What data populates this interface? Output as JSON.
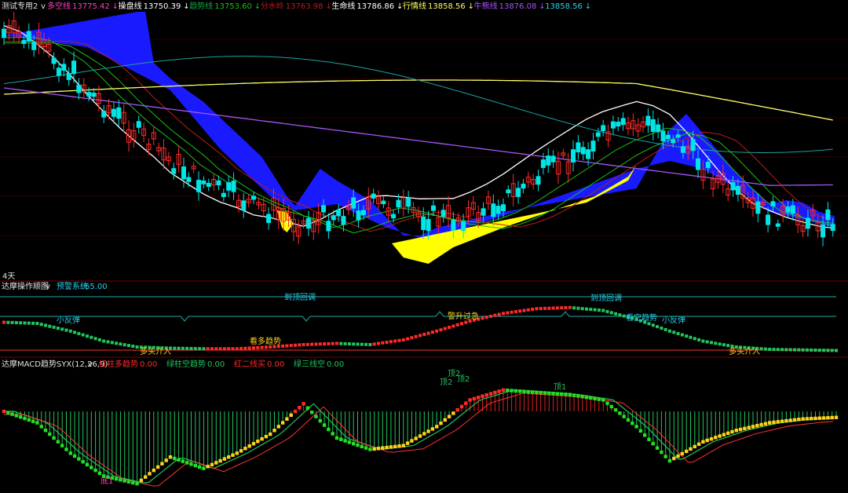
{
  "top_legend": {
    "selector_label": "测试专用2",
    "arrow": "v",
    "items": [
      {
        "name": "多空线",
        "value": "13775.42",
        "trend": "↓",
        "name_color": "#ff3fbf",
        "value_color": "#ff3fbf"
      },
      {
        "name": "操盘线",
        "value": "13750.39",
        "trend": "↓",
        "name_color": "#ffffff",
        "value_color": "#ffffff"
      },
      {
        "name": "趋势线",
        "value": "13753.60",
        "trend": "↓",
        "name_color": "#16a34a",
        "value_color": "#19c019"
      },
      {
        "name": "分水岭",
        "value": "13763.98",
        "trend": "↓",
        "name_color": "#b91c1c",
        "value_color": "#b91c1c"
      },
      {
        "name": "生命线",
        "value": "13786.86",
        "trend": "↓",
        "name_color": "#ffffff",
        "value_color": "#ffffff"
      },
      {
        "name": "行情线",
        "value": "13858.56",
        "trend": "↓",
        "name_color": "#ffff66",
        "value_color": "#ffff66"
      },
      {
        "name": "牛熊线",
        "value": "13876.08",
        "trend": "↓",
        "name_color": "#a855f7",
        "value_color": "#a855f7"
      },
      {
        "name": "",
        "value": "13858.56",
        "trend": "↓",
        "name_color": "#22d3ee",
        "value_color": "#22d3ee"
      }
    ]
  },
  "main_corner_label": "4天",
  "panel2": {
    "title": "达摩操作顺图",
    "arrow": "v",
    "sub_label": "预警系统",
    "sub_value": "65.00",
    "annotations": [
      {
        "text": "到顶回调",
        "color": "#22d3ee"
      },
      {
        "text": "小反弹",
        "color": "#22d3ee"
      },
      {
        "text": "警升过急",
        "color": "#ffd21a"
      },
      {
        "text": "到顶回调",
        "color": "#22d3ee"
      },
      {
        "text": "看空趋势",
        "color": "#22d3ee"
      },
      {
        "text": "小反弹",
        "color": "#22d3ee"
      },
      {
        "text": "多头介入",
        "color": "#ffd21a"
      },
      {
        "text": "看多趋势",
        "color": "#ffd21a"
      },
      {
        "text": "多头介入",
        "color": "#ffd21a"
      }
    ]
  },
  "panel3": {
    "title": "达摩MACD趋势SYX(12,26,9)",
    "arrow": "v",
    "items": [
      {
        "name": "红柱多趋势",
        "value": "0.00",
        "color": "#ff2b2b"
      },
      {
        "name": "绿柱空趋势",
        "value": "0.00",
        "color": "#22c55e"
      },
      {
        "name": "红二线买",
        "value": "0.00",
        "color": "#ff2b2b"
      },
      {
        "name": "绿三线空",
        "value": "0.00",
        "color": "#22c55e"
      }
    ],
    "annotations": [
      {
        "text": "顶2",
        "color": "#22c55e"
      },
      {
        "text": "顶2",
        "color": "#22c55e"
      },
      {
        "text": "顶2",
        "color": "#22c55e"
      },
      {
        "text": "顶1",
        "color": "#22c55e"
      },
      {
        "text": "底1",
        "color": "#ff3fbf"
      }
    ]
  },
  "colors": {
    "background": "#000000",
    "up_candle": "#ff2b2b",
    "down_candle": "#00e5e5",
    "blue_band": "#1a1aff",
    "yellow_band": "#ffff00",
    "divider": "#7a0000"
  },
  "chart_data": [
    {
      "type": "candlestick",
      "title": "测试专用2",
      "note": "main price panel with moving-average lines and shaded bands; prices approximate",
      "ylim": [
        13300,
        14500
      ],
      "close_points": [
        [
          0,
          14410
        ],
        [
          10,
          14395
        ],
        [
          20,
          14350
        ],
        [
          30,
          14300
        ],
        [
          40,
          14230
        ],
        [
          50,
          14150
        ],
        [
          60,
          14080
        ],
        [
          70,
          14010
        ],
        [
          80,
          13950
        ],
        [
          90,
          13890
        ],
        [
          100,
          13820
        ],
        [
          110,
          13770
        ],
        [
          120,
          13720
        ],
        [
          130,
          13680
        ],
        [
          140,
          13650
        ],
        [
          150,
          13610
        ],
        [
          160,
          13590
        ],
        [
          170,
          13560
        ],
        [
          180,
          13530
        ],
        [
          190,
          13550
        ],
        [
          200,
          13580
        ],
        [
          210,
          13600
        ],
        [
          220,
          13620
        ],
        [
          230,
          13610
        ],
        [
          240,
          13590
        ],
        [
          250,
          13570
        ],
        [
          260,
          13560
        ],
        [
          270,
          13550
        ],
        [
          280,
          13570
        ],
        [
          290,
          13600
        ],
        [
          300,
          13640
        ],
        [
          310,
          13690
        ],
        [
          320,
          13740
        ],
        [
          330,
          13790
        ],
        [
          340,
          13840
        ],
        [
          350,
          13890
        ],
        [
          360,
          13930
        ],
        [
          370,
          13960
        ],
        [
          380,
          13990
        ],
        [
          390,
          13980
        ],
        [
          400,
          13950
        ],
        [
          410,
          13880
        ],
        [
          420,
          13800
        ],
        [
          430,
          13720
        ],
        [
          440,
          13650
        ],
        [
          450,
          13600
        ],
        [
          460,
          13580
        ],
        [
          470,
          13560
        ],
        [
          480,
          13550
        ],
        [
          490,
          13540
        ]
      ],
      "series": [
        {
          "name": "多空线",
          "color": "#ff3fbf"
        },
        {
          "name": "操盘线",
          "color": "#ffffff"
        },
        {
          "name": "趋势线",
          "color": "#19c019"
        },
        {
          "name": "分水岭",
          "color": "#b91c1c"
        },
        {
          "name": "生命线",
          "color": "#ffffff"
        },
        {
          "name": "行情线",
          "color": "#ffff66"
        },
        {
          "name": "牛熊线",
          "color": "#a855f7"
        }
      ]
    },
    {
      "type": "line",
      "title": "达摩操作顺图",
      "ylim": [
        0,
        100
      ],
      "reference_lines": [
        65,
        50,
        0
      ],
      "x": [
        0,
        20,
        40,
        60,
        80,
        100,
        120,
        140,
        160,
        180,
        200,
        220,
        240,
        260,
        280,
        300,
        320,
        340,
        360,
        380,
        400,
        420,
        440,
        460,
        480,
        500
      ],
      "values": [
        50,
        48,
        35,
        18,
        8,
        6,
        5,
        5,
        8,
        12,
        14,
        12,
        20,
        35,
        52,
        65,
        73,
        75,
        70,
        55,
        35,
        18,
        8,
        4,
        3,
        2
      ]
    },
    {
      "type": "bar",
      "title": "达摩MACD趋势SYX(12,26,9)",
      "note": "histogram around zero; red above, green below",
      "ylim": [
        -100,
        40
      ],
      "x": [
        0,
        20,
        40,
        60,
        80,
        100,
        120,
        140,
        160,
        180,
        200,
        220,
        240,
        260,
        280,
        300,
        320,
        340,
        360,
        380,
        400,
        420,
        440,
        460,
        480,
        500
      ],
      "values": [
        0,
        -15,
        -55,
        -85,
        -95,
        -60,
        -75,
        -55,
        -30,
        10,
        -35,
        -50,
        -45,
        -20,
        15,
        28,
        25,
        22,
        15,
        -20,
        -65,
        -40,
        -25,
        -15,
        -10,
        -8
      ]
    }
  ]
}
